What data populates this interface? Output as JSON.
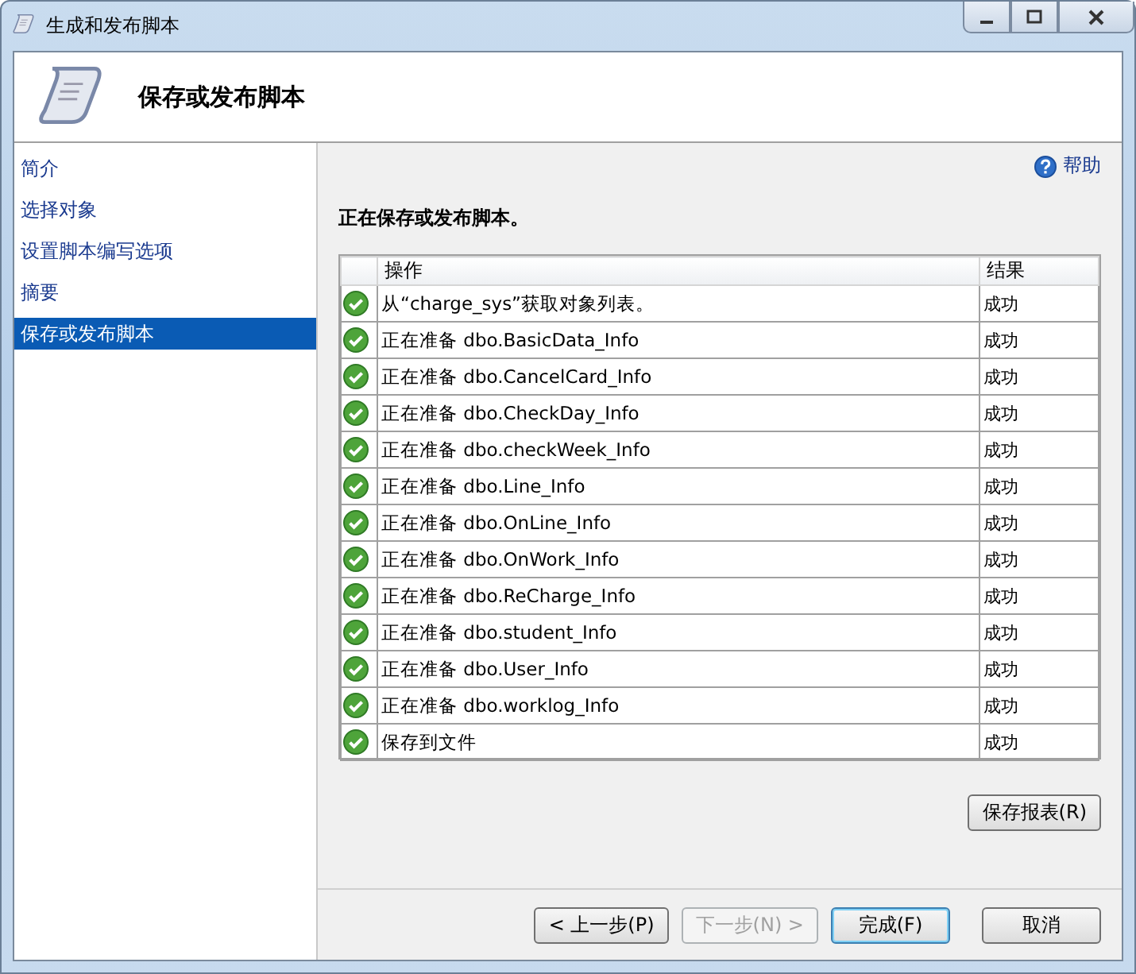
{
  "window": {
    "title": "生成和发布脚本"
  },
  "header": {
    "title": "保存或发布脚本"
  },
  "sidebar": {
    "items": [
      {
        "label": "简介",
        "selected": false
      },
      {
        "label": "选择对象",
        "selected": false
      },
      {
        "label": "设置脚本编写选项",
        "selected": false
      },
      {
        "label": "摘要",
        "selected": false
      },
      {
        "label": "保存或发布脚本",
        "selected": true
      }
    ]
  },
  "help_link": "帮助",
  "status_heading": "正在保存或发布脚本。",
  "table": {
    "columns": [
      "操作",
      "结果"
    ],
    "rows": [
      {
        "kind": "success",
        "action": "从“charge_sys”获取对象列表。",
        "result": "成功"
      },
      {
        "kind": "success",
        "action": "正在准备 dbo.BasicData_Info",
        "result": "成功"
      },
      {
        "kind": "success",
        "action": "正在准备 dbo.CancelCard_Info",
        "result": "成功"
      },
      {
        "kind": "success",
        "action": "正在准备 dbo.CheckDay_Info",
        "result": "成功"
      },
      {
        "kind": "success",
        "action": "正在准备 dbo.checkWeek_Info",
        "result": "成功"
      },
      {
        "kind": "success",
        "action": "正在准备 dbo.Line_Info",
        "result": "成功"
      },
      {
        "kind": "success",
        "action": "正在准备 dbo.OnLine_Info",
        "result": "成功"
      },
      {
        "kind": "success",
        "action": "正在准备 dbo.OnWork_Info",
        "result": "成功"
      },
      {
        "kind": "success",
        "action": "正在准备 dbo.ReCharge_Info",
        "result": "成功"
      },
      {
        "kind": "success",
        "action": "正在准备 dbo.student_Info",
        "result": "成功"
      },
      {
        "kind": "success",
        "action": "正在准备 dbo.User_Info",
        "result": "成功"
      },
      {
        "kind": "success",
        "action": "正在准备 dbo.worklog_Info",
        "result": "成功"
      },
      {
        "kind": "success",
        "action": "保存到文件",
        "result": "成功"
      }
    ]
  },
  "save_report_button": "保存报表(R)",
  "buttons": [
    {
      "label": "< 上一步(P)",
      "disabled": false,
      "default": false
    },
    {
      "label": "下一步(N) >",
      "disabled": true,
      "default": false
    },
    {
      "label": "完成(F)",
      "disabled": false,
      "default": true
    },
    {
      "label": "取消",
      "disabled": false,
      "default": false
    }
  ]
}
